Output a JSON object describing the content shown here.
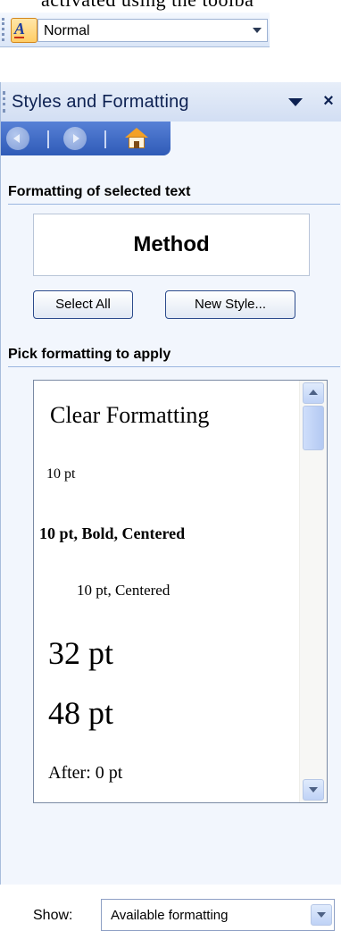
{
  "caption": "activated   using   the   toolba",
  "style_toolbar": {
    "style_value": "Normal",
    "icon": "styles-and-formatting-icon"
  },
  "task_pane": {
    "title": "Styles and Formatting",
    "nav": {
      "back_icon": "back-arrow-icon",
      "forward_icon": "forward-arrow-icon",
      "home_icon": "home-icon"
    },
    "selected_section": {
      "label": "Formatting of selected text",
      "preview": "Method"
    },
    "buttons": {
      "select_all": "Select All",
      "new_style": "New Style..."
    },
    "pick_section": {
      "label": "Pick formatting to apply",
      "items": [
        "Clear Formatting",
        "10 pt",
        "10 pt, Bold, Centered",
        "10 pt, Centered",
        "32 pt",
        "48 pt",
        "After:  0 pt"
      ]
    },
    "show": {
      "label": "Show:",
      "value": "Available formatting"
    }
  }
}
